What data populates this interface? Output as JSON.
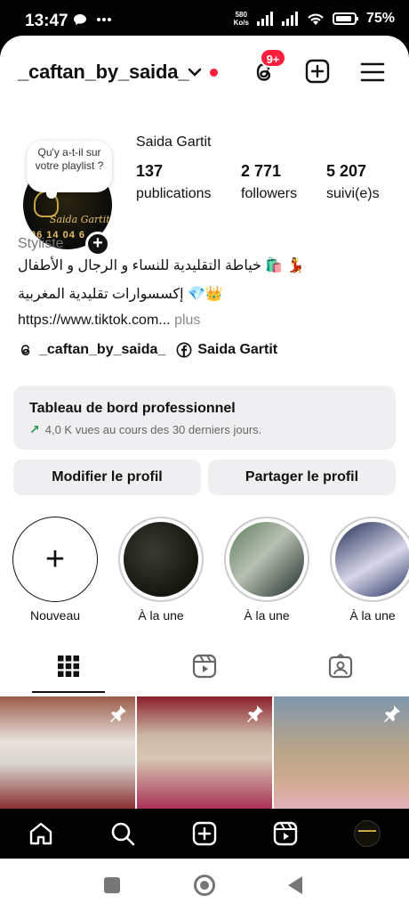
{
  "status_bar": {
    "time": "13:47",
    "speed_value": "580",
    "speed_unit": "Ko/s",
    "battery": "75"
  },
  "top_bar": {
    "username": "_caftan_by_saida_",
    "notification_badge": "9+"
  },
  "profile": {
    "note": "Qu'y a-t-il sur votre playlist ?",
    "avatar_logo_name": "Saida Gartit",
    "avatar_logo_phone": "06 14 04 6",
    "display_name": "Saida Gartit",
    "stats": [
      {
        "value": "137",
        "label": "publications"
      },
      {
        "value": "2 771",
        "label": "followers"
      },
      {
        "value": "5 207",
        "label": "suivi(e)s"
      }
    ],
    "category": "Styliste",
    "bio_line1": "خياطة التقليدية للنساء و الرجال و الأطفال 🛍️ 💃",
    "bio_line2": "إكسسوارات تقليدية المغربية 💎👑",
    "link": "https://www.tiktok.com...",
    "link_more": "plus",
    "threads_handle": "_caftan_by_saida_",
    "facebook_name": "Saida Gartit"
  },
  "dashboard": {
    "title": "Tableau de bord professionnel",
    "subtitle": "4,0 K vues au cours des 30 derniers jours."
  },
  "buttons": {
    "edit": "Modifier le profil",
    "share": "Partager le profil"
  },
  "highlights": [
    {
      "label": "Nouveau"
    },
    {
      "label": "À la une"
    },
    {
      "label": "À la une"
    },
    {
      "label": "À la une"
    }
  ],
  "colors": {
    "accent_red": "#ff1f3d",
    "growth_green": "#2e9a4c",
    "card_bg": "#efeff1"
  }
}
